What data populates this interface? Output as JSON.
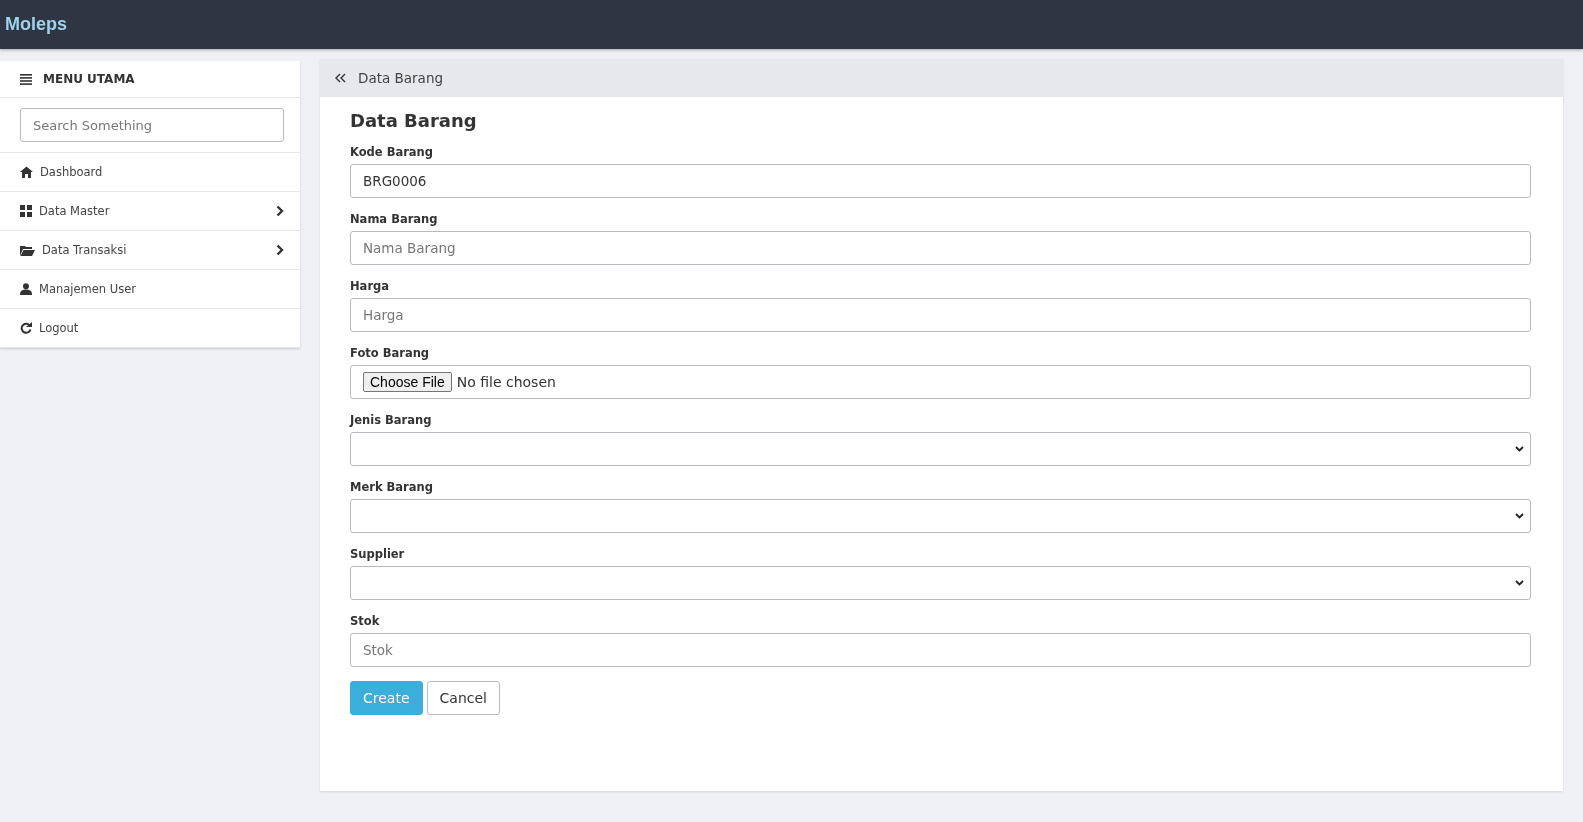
{
  "navbar": {
    "brand": "Moleps"
  },
  "sidebar": {
    "title": "MENU UTAMA",
    "search": {
      "placeholder": "Search Something"
    },
    "items": [
      {
        "label": "Dashboard",
        "has_submenu": false
      },
      {
        "label": "Data Master",
        "has_submenu": true
      },
      {
        "label": "Data Transaksi",
        "has_submenu": true
      },
      {
        "label": "Manajemen User",
        "has_submenu": false
      },
      {
        "label": "Logout",
        "has_submenu": false
      }
    ]
  },
  "breadcrumb": {
    "label": "Data Barang"
  },
  "form": {
    "title": "Data Barang",
    "fields": [
      {
        "kind": "text",
        "label": "Kode Barang",
        "value": "BRG0006"
      },
      {
        "kind": "text",
        "label": "Nama Barang",
        "placeholder": "Nama Barang"
      },
      {
        "kind": "text",
        "label": "Harga",
        "placeholder": "Harga"
      },
      {
        "kind": "file",
        "label": "Foto Barang",
        "button": "Choose File",
        "status": "No file chosen"
      },
      {
        "kind": "select",
        "label": "Jenis Barang"
      },
      {
        "kind": "select",
        "label": "Merk Barang"
      },
      {
        "kind": "select",
        "label": "Supplier"
      },
      {
        "kind": "text",
        "label": "Stok",
        "placeholder": "Stok"
      }
    ],
    "buttons": [
      {
        "kind": "primary",
        "label": "Create"
      },
      {
        "kind": "default",
        "label": "Cancel"
      }
    ]
  }
}
